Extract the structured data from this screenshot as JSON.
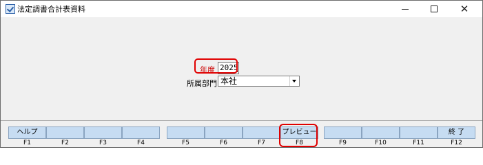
{
  "window": {
    "title": "法定調書合計表資料",
    "minimize_glyph": "",
    "maximize_glyph": "",
    "close_glyph": "✕"
  },
  "form": {
    "year_label": "年度",
    "year_value": "2025",
    "department_label": "所属部門",
    "department_value": "本社"
  },
  "function_keys": [
    {
      "key": "F1",
      "label": "ヘルプ"
    },
    {
      "key": "F2",
      "label": ""
    },
    {
      "key": "F3",
      "label": ""
    },
    {
      "key": "F4",
      "label": ""
    },
    {
      "key": "F5",
      "label": ""
    },
    {
      "key": "F6",
      "label": ""
    },
    {
      "key": "F7",
      "label": ""
    },
    {
      "key": "F8",
      "label": "プレビュー"
    },
    {
      "key": "F9",
      "label": ""
    },
    {
      "key": "F10",
      "label": ""
    },
    {
      "key": "F11",
      "label": ""
    },
    {
      "key": "F12",
      "label": "終 了"
    }
  ],
  "colors": {
    "highlight": "#e00000",
    "function_key_bg": "#c6dcf2",
    "year_label_color": "#cc0000"
  }
}
